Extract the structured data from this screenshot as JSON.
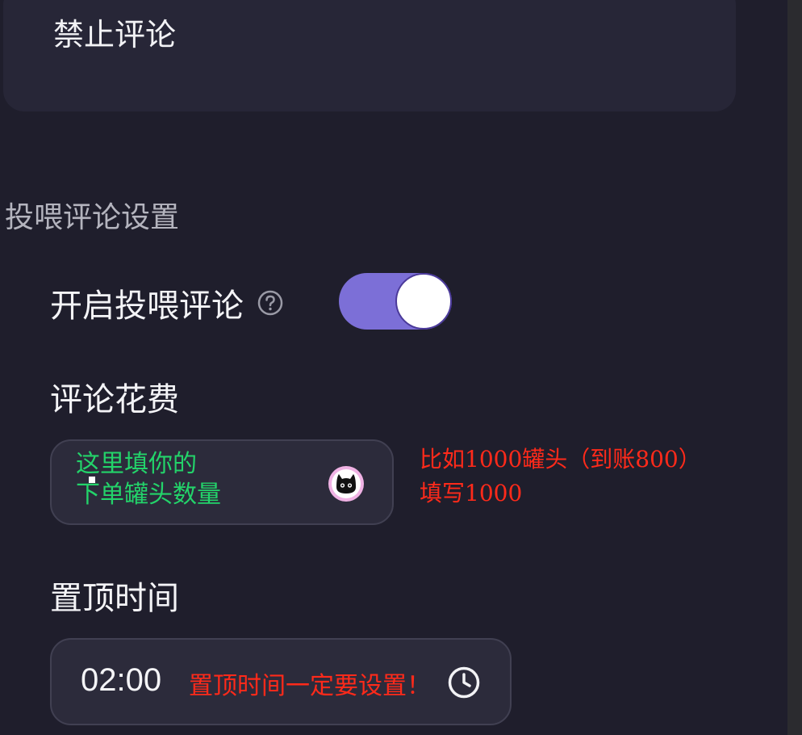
{
  "disable_comment": {
    "label": "禁止评论"
  },
  "feed_settings": {
    "header": "投喂评论设置",
    "enable_label": "开启投喂评论",
    "enable_state": "on",
    "help_icon": "question-circle-icon"
  },
  "cost": {
    "label": "评论花费",
    "input_annotation_line1": "这里填你的",
    "input_annotation_line2": "下单罐头数量",
    "coin_icon": "black-cat-coin-icon",
    "red_annotation_line1": "比如1000罐头（到账800）",
    "red_annotation_line2": "填写1000"
  },
  "pin_time": {
    "label": "置顶时间",
    "value": "02:00",
    "red_annotation": "置顶时间一定要设置！",
    "clock_icon": "clock-icon"
  },
  "colors": {
    "background": "#1f1e2c",
    "card": "#272637",
    "accent_toggle": "#7c6fd7",
    "annotation_green": "#23d36a",
    "annotation_red": "#ff2a1a"
  }
}
